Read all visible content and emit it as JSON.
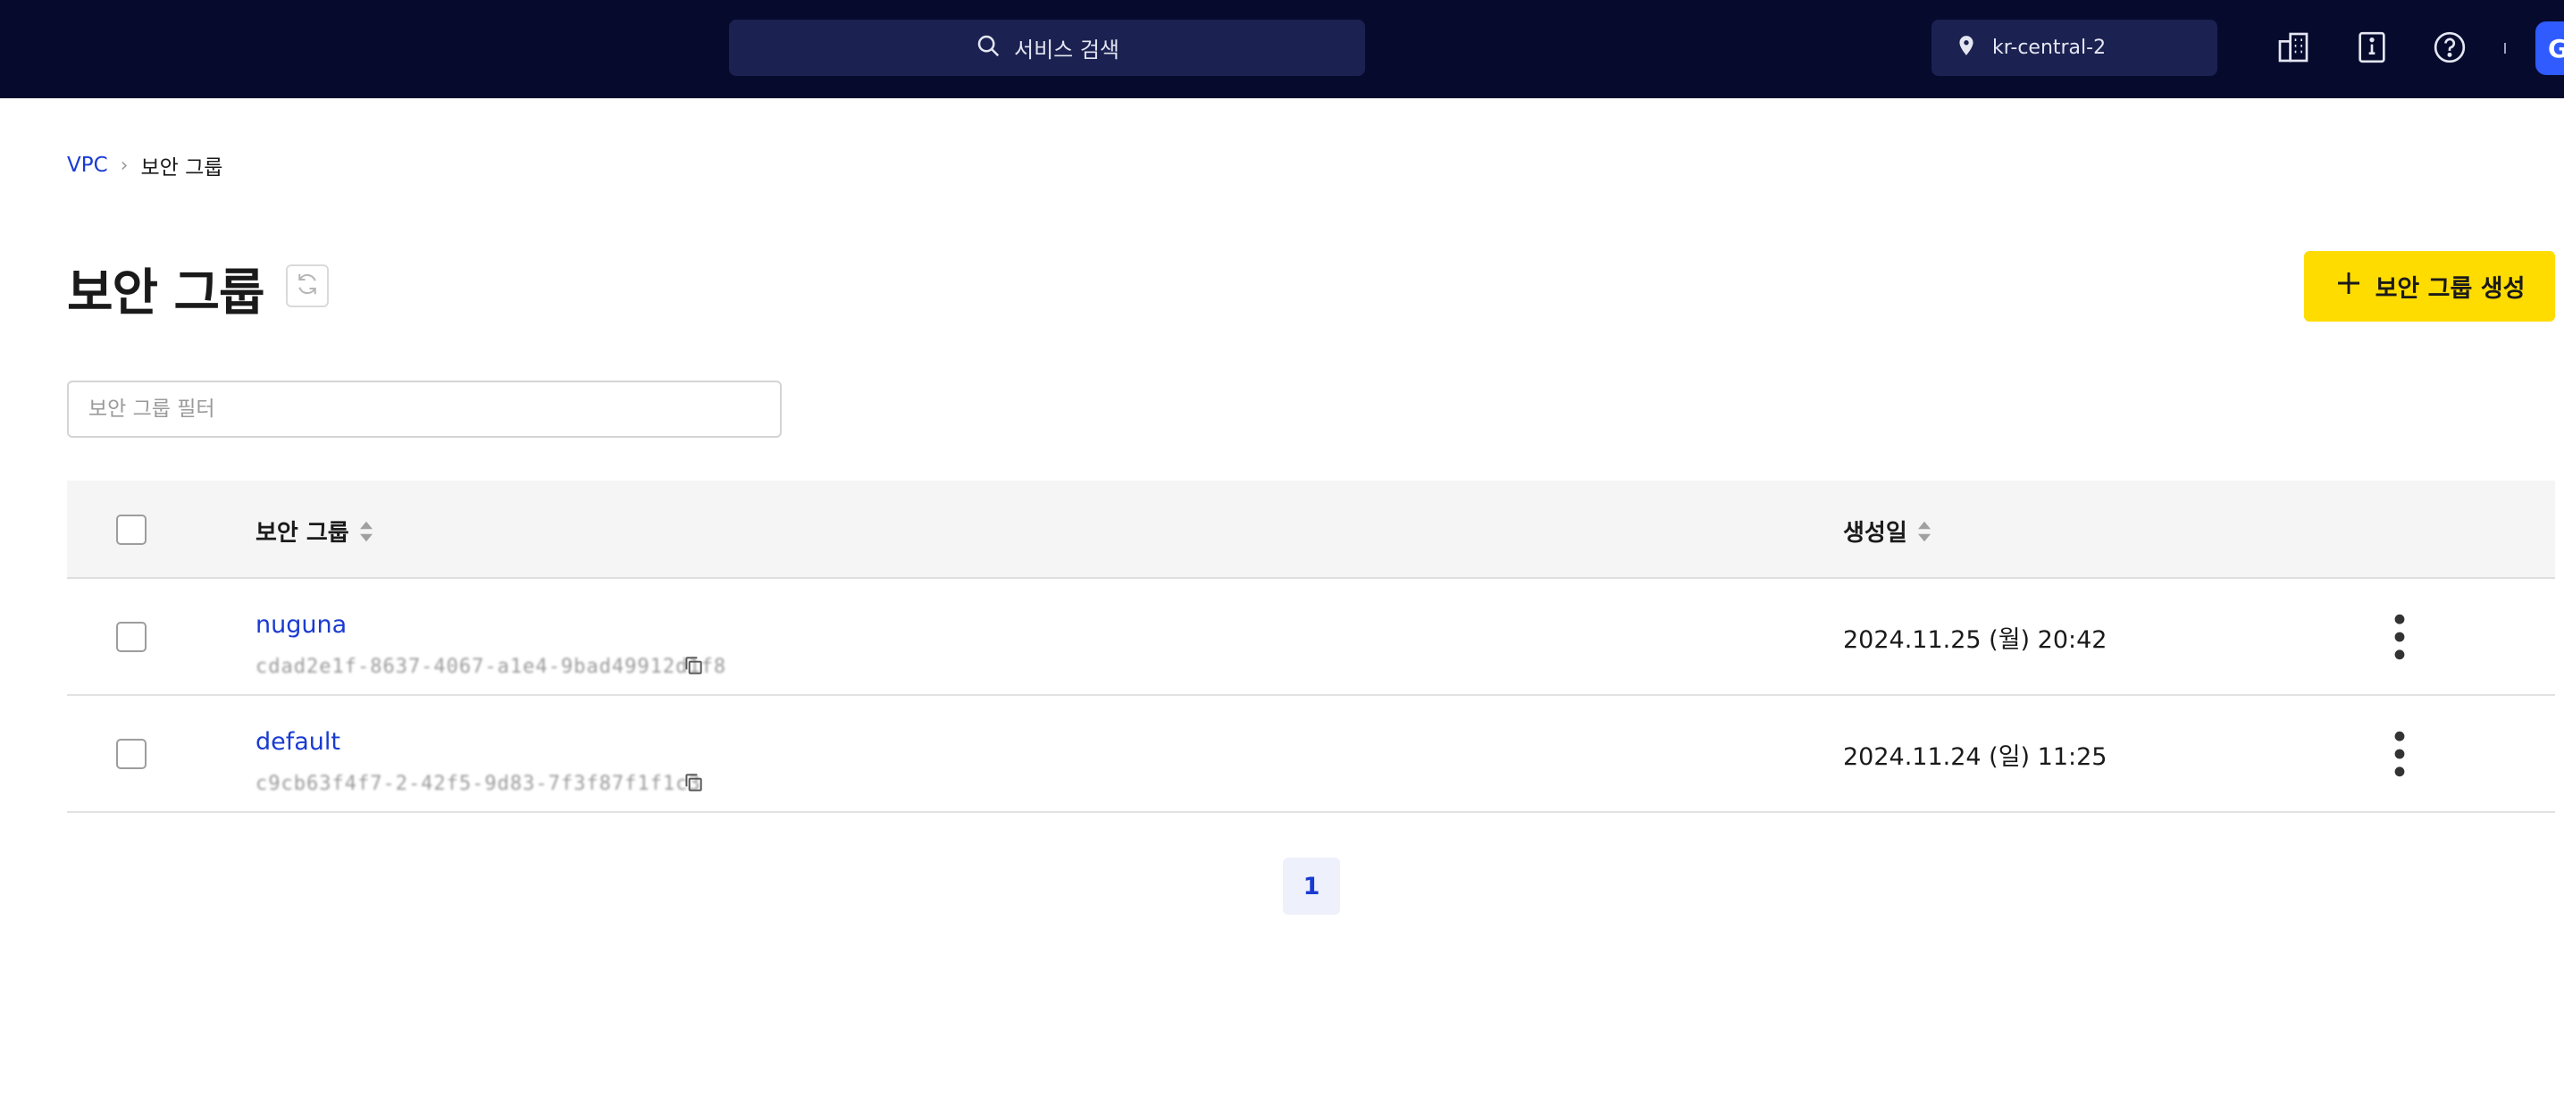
{
  "header": {
    "search_label": "서비스 검색",
    "region": "kr-central-2",
    "avatar_letter": "G"
  },
  "breadcrumb": {
    "parent": "VPC",
    "current": "보안 그룹"
  },
  "page": {
    "title": "보안 그룹",
    "create_label": "보안 그룹 생성",
    "filter_placeholder": "보안 그룹 필터"
  },
  "table": {
    "columns": {
      "name": "보안 그룹",
      "created": "생성일"
    },
    "rows": [
      {
        "name": "nuguna",
        "id": "cdad2e1f-8637-4067-a1e4-9bad49912d1f8",
        "created": "2024.11.25 (월) 20:42"
      },
      {
        "name": "default",
        "id": "c9cb63f4f7-2-42f5-9d83-7f3f87f1f1c3",
        "created": "2024.11.24 (일) 11:25"
      }
    ]
  },
  "pagination": {
    "current_page": "1"
  },
  "colors": {
    "topbar": "#060b2e",
    "primary_link": "#1a3bd1",
    "accent_button": "#ffdc00",
    "avatar": "#2f5bff"
  }
}
